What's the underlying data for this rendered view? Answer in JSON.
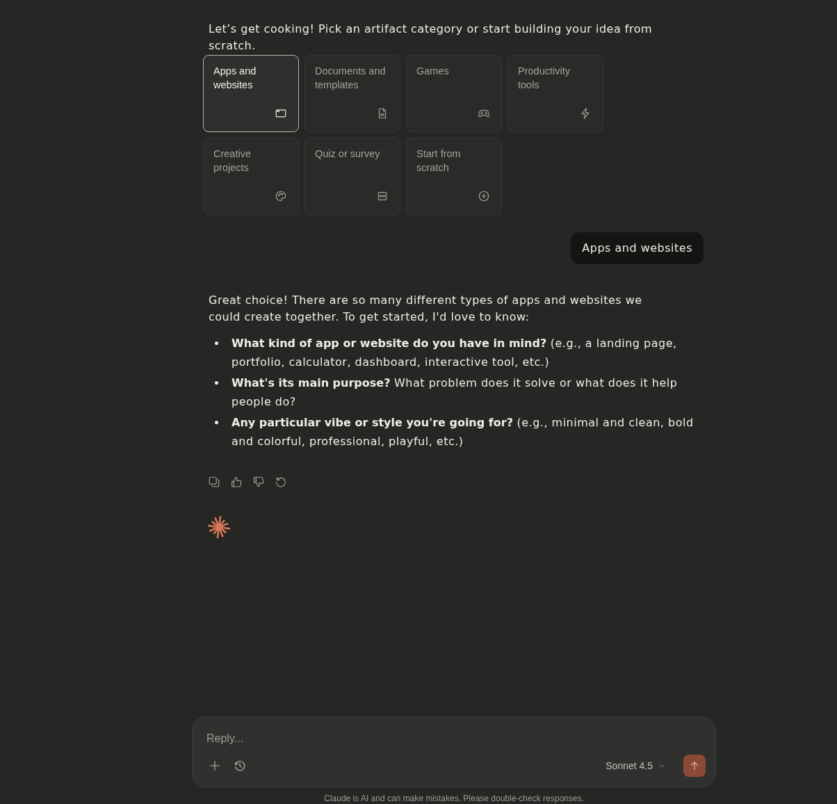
{
  "intro": "Let’s get cooking! Pick an artifact category or start building your idea from scratch.",
  "categories": [
    {
      "label": "Apps and websites",
      "kind": "browser",
      "selected": true
    },
    {
      "label": "Documents and templates",
      "kind": "document",
      "selected": false
    },
    {
      "label": "Games",
      "kind": "gamepad",
      "selected": false
    },
    {
      "label": "Productivity tools",
      "kind": "lightning",
      "selected": false
    },
    {
      "label": "Creative projects",
      "kind": "palette",
      "selected": false
    },
    {
      "label": "Quiz or survey",
      "kind": "stack",
      "selected": false
    },
    {
      "label": "Start from scratch",
      "kind": "plus",
      "selected": false
    }
  ],
  "user_message": {
    "text": "Apps and websites"
  },
  "response": {
    "paragraph": "Great choice! There are so many different types of apps and websites we could create together. To get started, I'd love to know:",
    "bullets": [
      "**What kind of app or website do you have in mind?** (e.g., a landing page, portfolio, calculator, dashboard, interactive tool, etc.)",
      "**What's its main purpose?** What problem does it solve or what does it help people do?",
      "**Any particular vibe or style you're going for?** (e.g., minimal and clean, bold and colorful, professional, playful, etc.)"
    ]
  },
  "composer": {
    "placeholder": "Reply...",
    "model": "Sonnet 4.5",
    "send_button": {
      "disabled": true
    }
  },
  "footer": "Claude is AI and can make mistakes. Please double-check responses."
}
